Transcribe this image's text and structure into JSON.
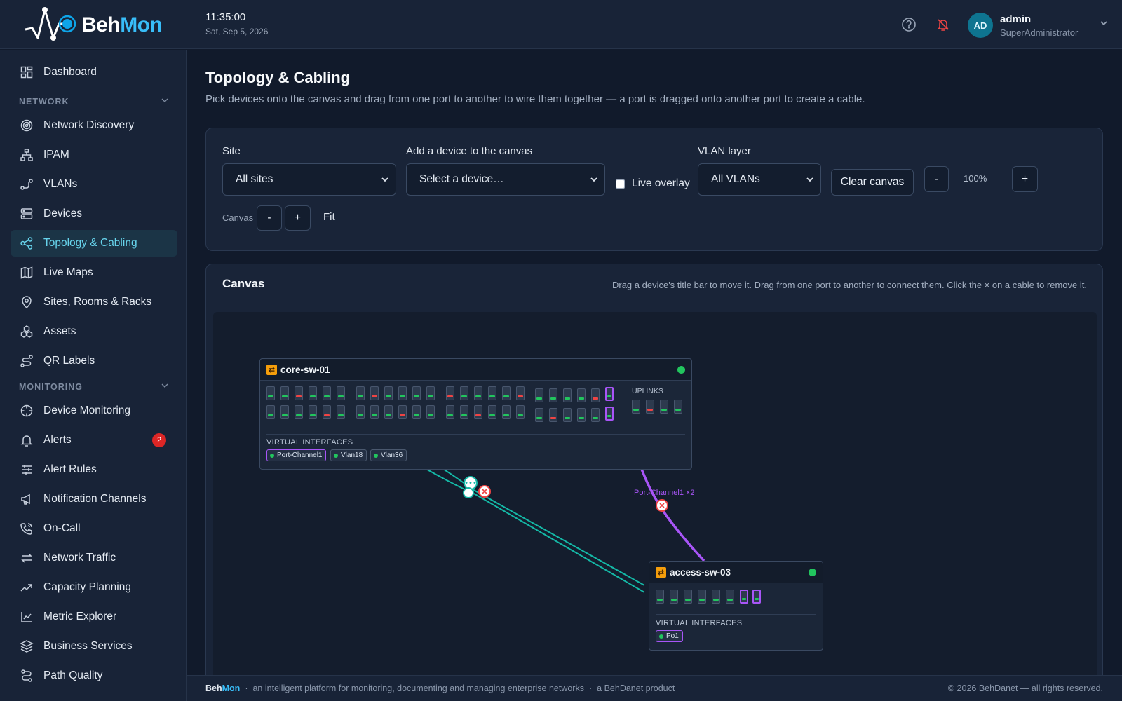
{
  "header": {
    "brand_a": "Beh",
    "brand_b": "Mon",
    "time": "11:35:00",
    "date": "Sat, Sep 5, 2026",
    "user": {
      "initials": "AD",
      "name": "admin",
      "role": "SuperAdministrator"
    }
  },
  "sidebar": {
    "top": {
      "label": "Dashboard",
      "icon": "dashboard-icon"
    },
    "section_network": "NETWORK",
    "network": [
      {
        "label": "Network Discovery",
        "icon": "radar-icon"
      },
      {
        "label": "IPAM",
        "icon": "hierarchy-icon"
      },
      {
        "label": "VLANs",
        "icon": "vlan-icon"
      },
      {
        "label": "Devices",
        "icon": "server-icon"
      },
      {
        "label": "Topology & Cabling",
        "icon": "share-nodes-icon",
        "active": true
      },
      {
        "label": "Live Maps",
        "icon": "map-icon"
      },
      {
        "label": "Sites, Rooms & Racks",
        "icon": "location-pin-icon"
      },
      {
        "label": "Assets",
        "icon": "boxes-icon"
      },
      {
        "label": "QR Labels",
        "icon": "route-icon"
      }
    ],
    "section_monitoring": "MONITORING",
    "monitoring": [
      {
        "label": "Device Monitoring",
        "icon": "crosshair-icon"
      },
      {
        "label": "Alerts",
        "icon": "bell-icon",
        "badge": "2"
      },
      {
        "label": "Alert Rules",
        "icon": "sliders-icon"
      },
      {
        "label": "Notification Channels",
        "icon": "megaphone-icon"
      },
      {
        "label": "On-Call",
        "icon": "phone-icon"
      },
      {
        "label": "Network Traffic",
        "icon": "arrows-swap-icon"
      },
      {
        "label": "Capacity Planning",
        "icon": "trend-up-icon"
      },
      {
        "label": "Metric Explorer",
        "icon": "line-chart-icon"
      },
      {
        "label": "Business Services",
        "icon": "layers-icon"
      },
      {
        "label": "Path Quality",
        "icon": "path-icon"
      }
    ]
  },
  "page": {
    "title": "Topology & Cabling",
    "subtitle": "Pick devices onto the canvas and drag from one port to another to wire them together — a port is dragged onto another port to create a cable."
  },
  "toolbar": {
    "site_label": "Site",
    "site_value": "All sites",
    "device_label": "Add a device to the canvas",
    "device_value": "Select a device…",
    "live_overlay": "Live overlay",
    "vlan_label": "VLAN layer",
    "vlan_value": "All VLANs",
    "clear": "Clear canvas",
    "zoom_minus": "-",
    "zoom_value": "100%",
    "zoom_plus": "+",
    "canvas_label": "Canvas",
    "canvas_minus": "-",
    "canvas_plus": "+",
    "fit": "Fit"
  },
  "canvas": {
    "title": "Canvas",
    "hint": "Drag a device's title bar to move it. Drag from one port to another to connect them. Click the × on a cable to remove it.",
    "cable_label": "Port-Channel1 ×2",
    "colors": {
      "up": "#22c55e",
      "down": "#ef4444",
      "portchannel": "#a855f7",
      "cable": "#14b8a6"
    },
    "devices": {
      "core": {
        "name": "core-sw-01",
        "uplinks": "UPLINKS",
        "vi_label": "VIRTUAL INTERFACES",
        "interfaces": [
          "Port-Channel1",
          "Vlan18",
          "Vlan36"
        ]
      },
      "access": {
        "name": "access-sw-03",
        "vi_label": "VIRTUAL INTERFACES",
        "interfaces": [
          "Po1"
        ]
      }
    }
  },
  "footer": {
    "brand_a": "Beh",
    "brand_b": "Mon",
    "tagline": "an intelligent platform for monitoring, documenting and managing enterprise networks",
    "product": "a BehDanet product",
    "copyright": "© 2026 BehDanet — all rights reserved."
  }
}
